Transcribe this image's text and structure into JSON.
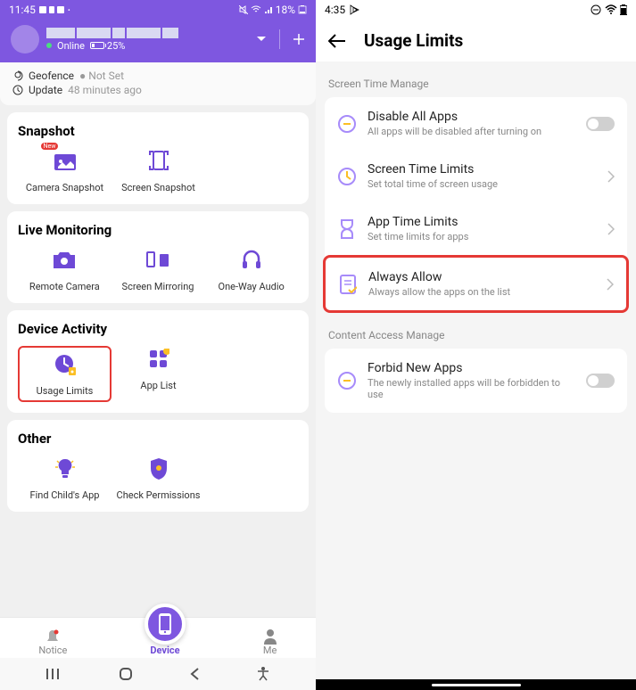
{
  "left": {
    "statusbar": {
      "time": "11:45",
      "battery": "18%"
    },
    "header": {
      "online": "Online",
      "battery_pct": "25%"
    },
    "info": {
      "geofence_label": "Geofence",
      "geofence_value": "Not Set",
      "update_label": "Update",
      "update_value": "48 minutes ago"
    },
    "snapshot": {
      "title": "Snapshot",
      "camera": "Camera Snapshot",
      "screen": "Screen Snapshot",
      "new_badge": "New"
    },
    "live": {
      "title": "Live Monitoring",
      "remote": "Remote Camera",
      "mirror": "Screen Mirroring",
      "audio": "One-Way Audio"
    },
    "activity": {
      "title": "Device Activity",
      "usage": "Usage Limits",
      "applist": "App List"
    },
    "other": {
      "title": "Other",
      "find": "Find Child's App",
      "perms": "Check Permissions"
    },
    "nav": {
      "notice": "Notice",
      "device": "Device",
      "me": "Me"
    }
  },
  "right": {
    "statusbar": {
      "time": "4:35"
    },
    "title": "Usage Limits",
    "section1": "Screen Time Manage",
    "disable": {
      "title": "Disable All Apps",
      "sub": "All apps will be disabled after turning on"
    },
    "screentime": {
      "title": "Screen Time Limits",
      "sub": "Set total time of screen usage"
    },
    "apptime": {
      "title": "App Time Limits",
      "sub": "Set time limits for apps"
    },
    "always": {
      "title": "Always Allow",
      "sub": "Always allow the apps on the list"
    },
    "section2": "Content Access Manage",
    "forbid": {
      "title": "Forbid New Apps",
      "sub": "The newly installed apps will be forbidden to use"
    }
  }
}
